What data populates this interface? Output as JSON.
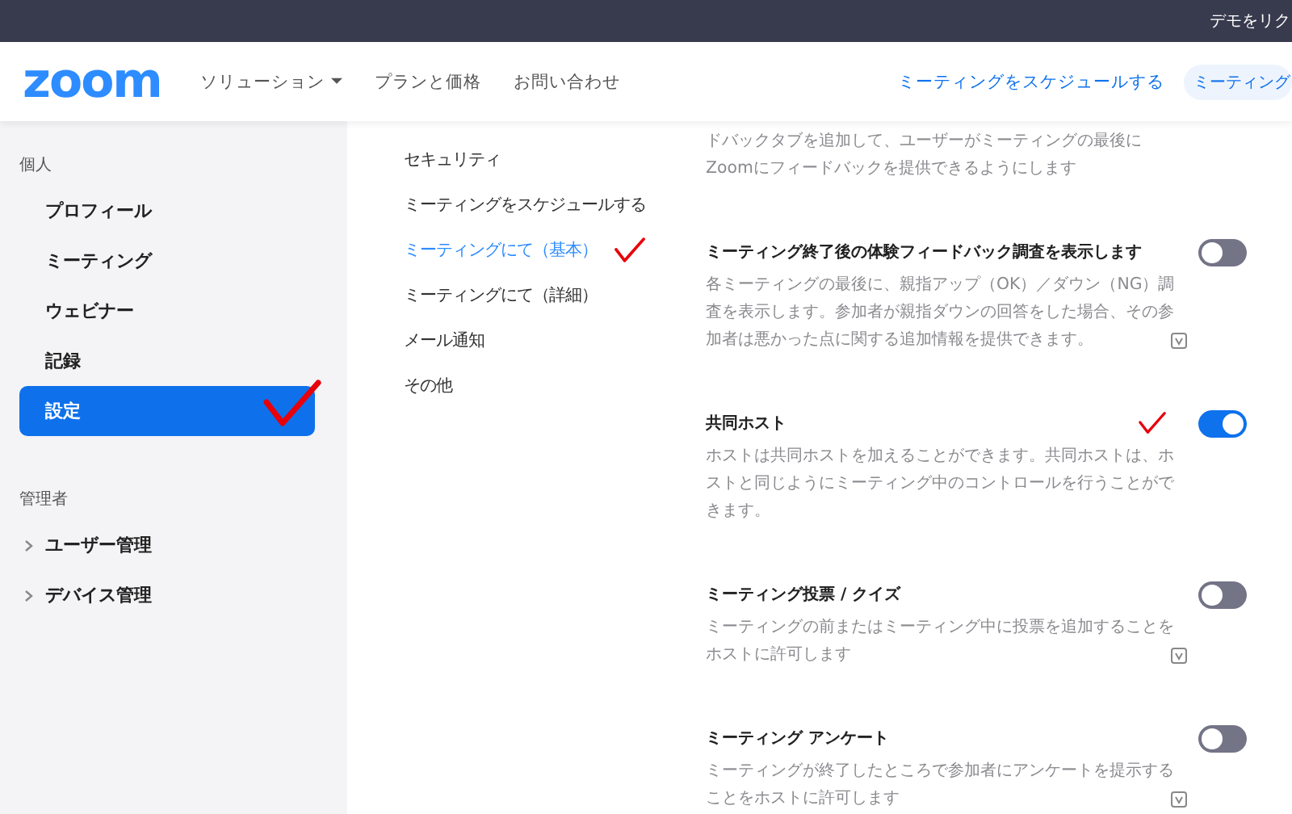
{
  "top_bar": {
    "link": "デモをリク"
  },
  "header": {
    "logo": "zoom",
    "nav": [
      {
        "label": "ソリューション",
        "dropdown": true
      },
      {
        "label": "プランと価格",
        "dropdown": false
      },
      {
        "label": "お問い合わせ",
        "dropdown": false
      }
    ],
    "actions": [
      {
        "label": "ミーティングをスケジュールする",
        "kind": "link"
      },
      {
        "label": "ミーティング",
        "kind": "pill"
      }
    ]
  },
  "sidebar": {
    "sections": [
      {
        "heading": "個人",
        "items": [
          {
            "label": "プロフィール",
            "selected": false,
            "expandable": false,
            "annotated": false
          },
          {
            "label": "ミーティング",
            "selected": false,
            "expandable": false,
            "annotated": false
          },
          {
            "label": "ウェビナー",
            "selected": false,
            "expandable": false,
            "annotated": false
          },
          {
            "label": "記録",
            "selected": false,
            "expandable": false,
            "annotated": false
          },
          {
            "label": "設定",
            "selected": true,
            "expandable": false,
            "annotated": true
          }
        ]
      },
      {
        "heading": "管理者",
        "items": [
          {
            "label": "ユーザー管理",
            "selected": false,
            "expandable": true,
            "annotated": false
          },
          {
            "label": "デバイス管理",
            "selected": false,
            "expandable": true,
            "annotated": false
          }
        ]
      }
    ]
  },
  "subnav": [
    {
      "label": "セキュリティ",
      "selected": false,
      "annotated": false
    },
    {
      "label": "ミーティングをスケジュールする",
      "selected": false,
      "annotated": false
    },
    {
      "label": "ミーティングにて（基本）",
      "selected": true,
      "annotated": true
    },
    {
      "label": "ミーティングにて（詳細）",
      "selected": false,
      "annotated": false
    },
    {
      "label": "メール通知",
      "selected": false,
      "annotated": false
    },
    {
      "label": "その他",
      "selected": false,
      "annotated": false
    }
  ],
  "settings": [
    {
      "description": "ドバックタブを追加して、ユーザーがミーティングの最後にZoomにフィードバックを提供できるようにします",
      "info_icon": false,
      "annotated": false
    },
    {
      "title": "ミーティング終了後の体験フィードバック調査を表示します",
      "description": "各ミーティングの最後に、親指アップ（OK）／ダウン（NG）調査を表示します。参加者が親指ダウンの回答をした場合、その参加者は悪かった点に関する追加情報を提供できます。",
      "on": false,
      "info_icon": true,
      "annotated": false
    },
    {
      "title": "共同ホスト",
      "description": "ホストは共同ホストを加えることができます。共同ホストは、ホストと同じようにミーティング中のコントロールを行うことができます。",
      "on": true,
      "info_icon": false,
      "annotated": true
    },
    {
      "title": "ミーティング投票 / クイズ",
      "description": "ミーティングの前またはミーティング中に投票を追加することをホストに許可します",
      "on": false,
      "info_icon": true,
      "annotated": false
    },
    {
      "title": "ミーティング アンケート",
      "description": "ミーティングが終了したところで参加者にアンケートを提示することをホストに許可します",
      "on": false,
      "info_icon": true,
      "annotated": false
    }
  ]
}
